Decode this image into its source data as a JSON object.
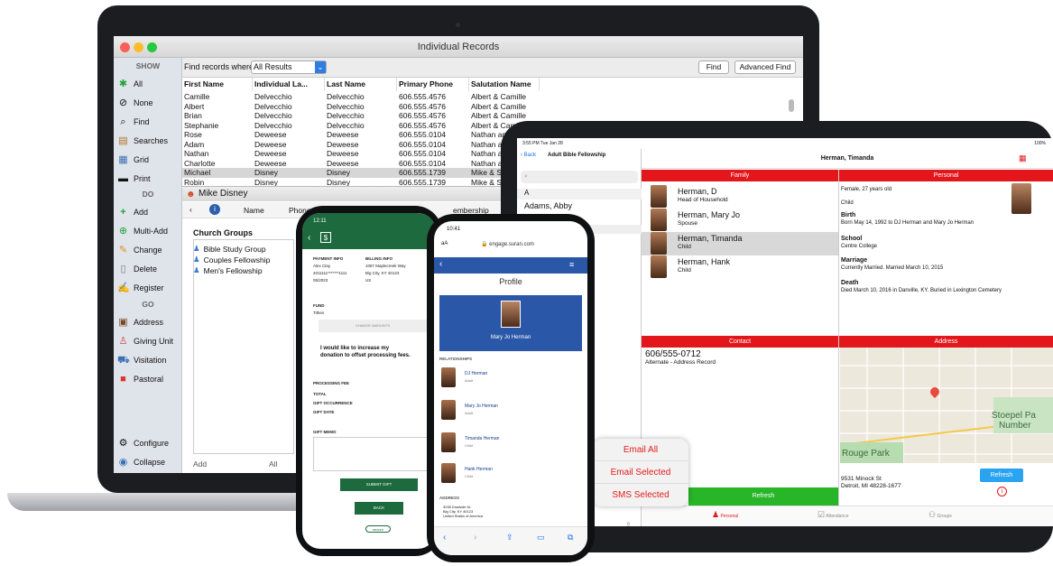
{
  "mac": {
    "window_title": "Individual Records",
    "sidebar": {
      "show_header": "SHOW",
      "do_header": "DO",
      "go_header": "GO",
      "show_items": [
        "All",
        "None",
        "Find",
        "Searches",
        "Grid",
        "Print"
      ],
      "do_items": [
        "Add",
        "Multi-Add",
        "Change",
        "Delete",
        "Register"
      ],
      "go_items": [
        "Address",
        "Giving Unit",
        "Visitation",
        "Pastoral"
      ],
      "bottom_items": [
        "Configure",
        "Collapse"
      ]
    },
    "findbar": {
      "label": "Find records where",
      "select_value": "All Results",
      "find_button": "Find",
      "advanced_button": "Advanced Find"
    },
    "table": {
      "headers": [
        "First Name",
        "Individual La...",
        "Last Name",
        "Primary Phone",
        "Salutation Name"
      ],
      "rows": [
        [
          "Camille",
          "Delvecchio",
          "Delvecchio",
          "606.555.4576",
          "Albert & Camille"
        ],
        [
          "Albert",
          "Delvecchio",
          "Delvecchio",
          "606.555.4576",
          "Albert & Camille"
        ],
        [
          "Brian",
          "Delvecchio",
          "Delvecchio",
          "606.555.4576",
          "Albert & Camille"
        ],
        [
          "Stephanie",
          "Delvecchio",
          "Delvecchio",
          "606.555.4576",
          "Albert & Camil"
        ],
        [
          "Rose",
          "Deweese",
          "Deweese",
          "606.555.0104",
          "Nathan and"
        ],
        [
          "Adam",
          "Deweese",
          "Deweese",
          "606.555.0104",
          "Nathan and"
        ],
        [
          "Nathan",
          "Deweese",
          "Deweese",
          "606.555.0104",
          "Nathan ar"
        ],
        [
          "Charlotte",
          "Deweese",
          "Deweese",
          "606.555.0104",
          "Nathan ar"
        ],
        [
          "Michael",
          "Disney",
          "Disney",
          "606.555.1739",
          "Mike & Su"
        ],
        [
          "Robin",
          "Disney",
          "Disney",
          "606.555.1739",
          "Mike & S"
        ]
      ]
    },
    "detail": {
      "title": "Mike Disney",
      "tab_name": "Name",
      "tab_phone": "Phone",
      "tab_membership": "embership",
      "groups_heading": "Church Groups",
      "groups": [
        "Bible Study Group",
        "Couples Fellowship",
        "Men's Fellowship"
      ],
      "add_button": "Add",
      "all_button": "All"
    }
  },
  "ipad": {
    "status_time": "3:55 PM  Tue Jan 28",
    "status_battery": "100%",
    "back_label": "Back",
    "list_title": "Adult Bible Fellowship",
    "index_letter": "A",
    "list_first": "Adams, Abby",
    "detail_title": "Herman, Timanda",
    "family_header": "Family",
    "personal_header": "Personal",
    "contact_header": "Contact",
    "address_header": "Address",
    "family": [
      {
        "name": "Herman, D",
        "role": "Head of Household"
      },
      {
        "name": "Herman, Mary Jo",
        "role": "Spouse"
      },
      {
        "name": "Herman, Timanda",
        "role": "Child"
      },
      {
        "name": "Herman, Hank",
        "role": "Child"
      }
    ],
    "personal_summary": "Female, 27 years old",
    "personal_role": "Child",
    "birth_label": "Birth",
    "birth_text": "Born May 14, 1992 to DJ Herman and Mary Jo Herman",
    "school_label": "School",
    "school_text": "Centre College",
    "marriage_label": "Marriage",
    "marriage_text": "Currently Married. Married March 10, 2015",
    "death_label": "Death",
    "death_text": "Died March 10, 2016 in Danville, KY. Buried in Lexington Cemetery",
    "contact_phone": "606/555-0712",
    "contact_sub": "Alternate - Address Record",
    "map_label1": "Stoepel Pa",
    "map_label2": "Number",
    "map_label3": "Rouge Park",
    "address_line1": "9531 Minock St",
    "address_line2": "Detroit, MI 48228-1677",
    "refresh_button": "Refresh",
    "refresh_bar": "Refresh",
    "tabs": [
      "Personal",
      "Attendance",
      "Groups"
    ],
    "accent": "#e3171b"
  },
  "actions": [
    "Email All",
    "Email Selected",
    "SMS Selected"
  ],
  "phone1": {
    "time": "12:11",
    "payment_info": "PAYMENT INFO",
    "billing_info": "BILLING INFO",
    "payer_name": "Alex Clay",
    "payer_card": "4011111*******1111",
    "payer_exp": "05/2023",
    "billing_addr1": "1087 Maplecreek Way",
    "billing_addr2": "Big City, KY 40123",
    "billing_country": "US",
    "fund_label": "FUND",
    "fund_value": "Tithes",
    "change_amounts": "CHANGE AMOUNTS",
    "increase_text": "I would like to increase my donation to offset processing fees.",
    "processing_fee": "PROCESSING FEE",
    "total": "TOTAL",
    "gift_occurrence": "GIFT OCCURRENCE",
    "gift_date": "GIFT DATE",
    "gift_memo": "GIFT MEMO",
    "submit": "SUBMIT GIFT",
    "back": "BACK",
    "secure": "secure"
  },
  "phone2": {
    "time": "10:41",
    "url": "engage.suran.com",
    "aa": "aA",
    "profile_title": "Profile",
    "profile_name": "Mary Jo Herman",
    "relationships": "RELATIONSHIPS",
    "relations": [
      {
        "name": "DJ Herman",
        "role": "Adult"
      },
      {
        "name": "Mary Jo Herman",
        "role": "Adult"
      },
      {
        "name": "Timanda Herman",
        "role": "Child"
      },
      {
        "name": "Hank Herman",
        "role": "Child"
      }
    ],
    "address_label": "ADDRESS",
    "address_lines": "3035 Eastside Dr.\nBig City, KY 40123\nUnited States of America",
    "brand_color": "#2b57a8"
  }
}
